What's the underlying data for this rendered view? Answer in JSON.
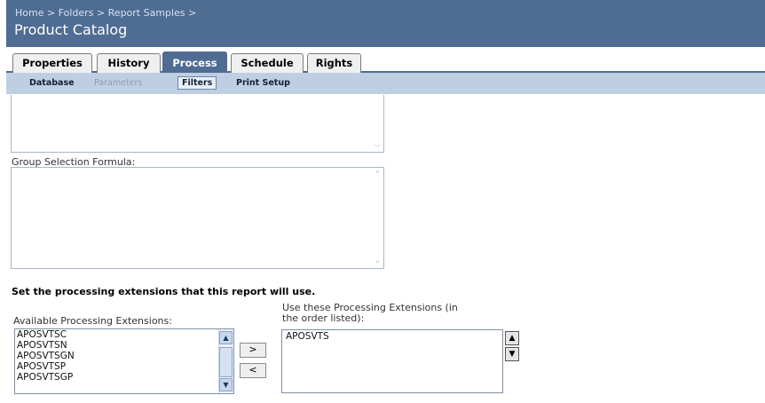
{
  "header": {
    "breadcrumb": [
      "Home",
      "Folders",
      "Report Samples"
    ],
    "separator": ">",
    "title": "Product Catalog"
  },
  "tabs": [
    {
      "label": "Properties",
      "active": false
    },
    {
      "label": "History",
      "active": false
    },
    {
      "label": "Process",
      "active": true
    },
    {
      "label": "Schedule",
      "active": false
    },
    {
      "label": "Rights",
      "active": false
    }
  ],
  "subtabs": [
    {
      "label": "Database",
      "state": "normal"
    },
    {
      "label": "Parameters",
      "state": "disabled"
    },
    {
      "label": "Filters",
      "state": "active"
    },
    {
      "label": "Print Setup",
      "state": "normal"
    }
  ],
  "form": {
    "group_selection_label": "Group Selection Formula:",
    "extensions_heading": "Set the processing extensions that this report will use.",
    "available_label": "Available Processing Extensions:",
    "use_label_line1": "Use these Processing Extensions (in",
    "use_label_line2": "the order listed):",
    "available_items": [
      "APOSVTSC",
      "APOSVTSN",
      "APOSVTSGN",
      "APOSVTSP",
      "APOSVTSGP"
    ],
    "selected_items": [
      "APOSVTS"
    ],
    "add_button": ">",
    "remove_button": "<",
    "move_up": "up-arrow",
    "move_down": "down-arrow"
  }
}
